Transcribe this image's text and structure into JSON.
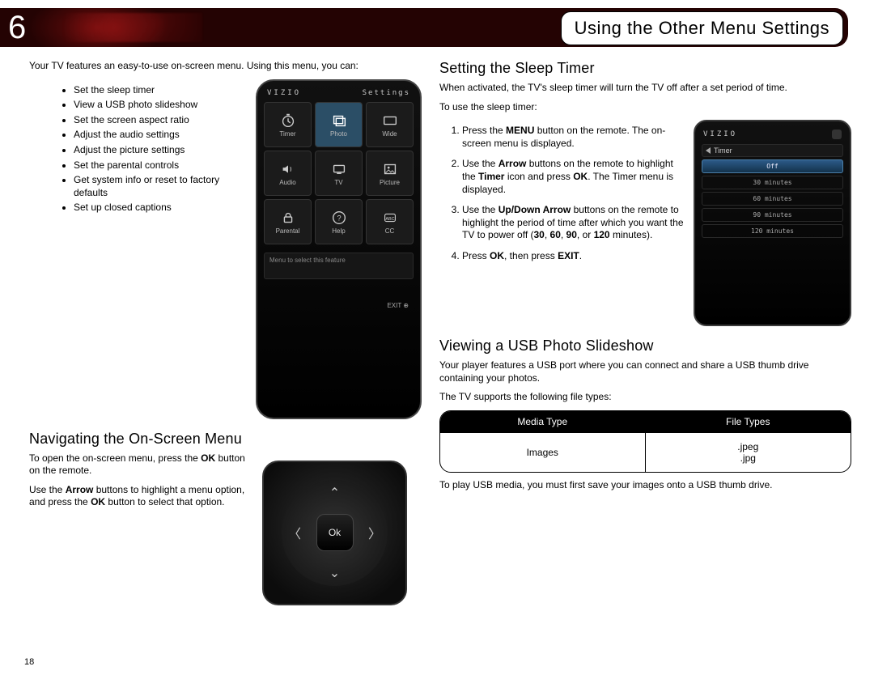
{
  "chapter": "6",
  "title": "Using the Other Menu Settings",
  "page_number": "18",
  "intro": "Your TV features an easy-to-use on-screen menu. Using this menu, you can:",
  "features": [
    "Set the sleep timer",
    "View a USB photo slideshow",
    "Set the screen aspect ratio",
    "Adjust the audio settings",
    "Adjust the picture settings",
    "Set the parental controls",
    "Get system info or reset to factory defaults",
    "Set up closed captions"
  ],
  "nav_heading": "Navigating the On-Screen Menu",
  "nav_p1a": "To open the on-screen menu, press the ",
  "nav_p1b": " button on the remote.",
  "nav_p2a": "Use the ",
  "nav_p2b": " buttons to highlight a menu option, and press the ",
  "nav_p2c": " button to select that option.",
  "bold": {
    "ok": "OK",
    "arrow": "Arrow",
    "menu": "MENU",
    "timer": "Timer",
    "updown": "Up/Down Arrow",
    "exit": "EXIT",
    "t30": "30",
    "t60": "60",
    "t90": "90",
    "t120": "120"
  },
  "sleep_heading": "Setting the Sleep Timer",
  "sleep_p1": "When activated, the TV's sleep timer will turn the TV off after a set period of time.",
  "sleep_p2": "To use the sleep timer:",
  "sleep_steps": {
    "s1a": "Press the ",
    "s1b": " button on the remote. The on-screen menu is displayed.",
    "s2a": "Use the ",
    "s2b": " buttons on the remote to highlight the ",
    "s2c": " icon and press ",
    "s2d": ". The Timer menu is displayed.",
    "s3a": "Use the ",
    "s3b": " buttons on the remote to highlight the period of time after which you want the TV to power off (",
    "s3c": ", ",
    "s3d": ", ",
    "s3e": ", or ",
    "s3f": " minutes).",
    "s4a": "Press ",
    "s4b": ", then press ",
    "s4c": "."
  },
  "usb_heading": "Viewing a USB Photo Slideshow",
  "usb_p1": "Your player features a USB port where you can connect and share a USB thumb drive containing your photos.",
  "usb_p2": "The TV supports the following file types:",
  "usb_p3": "To play USB media, you must first save your images onto a USB thumb drive.",
  "table": {
    "h1": "Media Type",
    "h2": "File Types",
    "r1": "Images",
    "r2": ".jpeg\n.jpg"
  },
  "phone": {
    "brand": "VIZIO",
    "settings": "Settings",
    "tiles": [
      "Timer",
      "Photo",
      "Wide",
      "Audio",
      "TV",
      "Picture",
      "Parental",
      "Help",
      "CC"
    ],
    "msg": "Menu to select this feature",
    "exit": "EXIT ⊕"
  },
  "remote": {
    "ok": "Ok"
  },
  "timer_panel": {
    "brand": "VIZIO",
    "back": "Timer",
    "items": [
      "Off",
      "30 minutes",
      "60 minutes",
      "90 minutes",
      "120 minutes"
    ]
  }
}
